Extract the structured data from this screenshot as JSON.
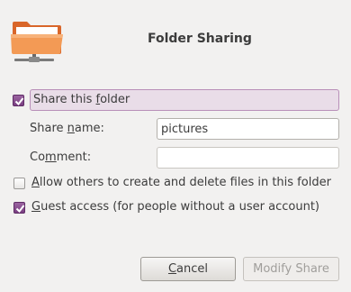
{
  "dialog": {
    "title": "Folder Sharing"
  },
  "share_folder": {
    "checked": true,
    "label_pre": "Share this ",
    "label_mnemonic": "f",
    "label_post": "older"
  },
  "share_name": {
    "label_pre": "Share ",
    "label_mnemonic": "n",
    "label_post": "ame:",
    "value": "pictures"
  },
  "comment": {
    "label_pre": "Co",
    "label_mnemonic": "m",
    "label_post": "ment:",
    "value": ""
  },
  "allow_others": {
    "checked": false,
    "label_mnemonic": "A",
    "label_post": "llow others to create and delete files in this folder"
  },
  "guest_access": {
    "checked": true,
    "label_mnemonic": "G",
    "label_post": "uest access (for people without a user account)"
  },
  "buttons": {
    "cancel_mnemonic": "C",
    "cancel_post": "ancel",
    "modify_label": "Modify Share"
  },
  "colors": {
    "accent": "#7a3f82",
    "highlight_bg": "#e9dde8",
    "folder": "#f07d3c"
  }
}
